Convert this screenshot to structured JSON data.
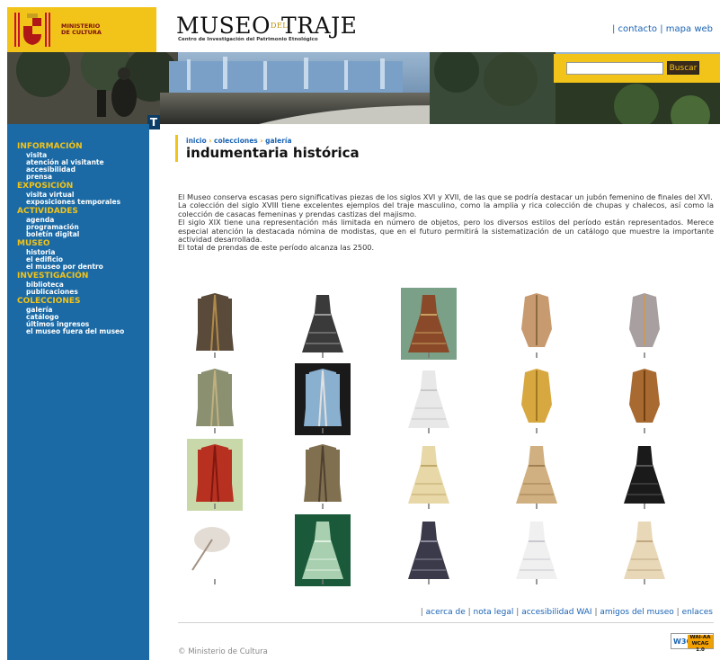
{
  "header": {
    "ministry_line1": "MINISTERIO",
    "ministry_line2": "DE CULTURA",
    "logo_part1": "MUSEO",
    "logo_part_del": "DEL",
    "logo_part2": "TRAJE",
    "logo_subtitle": "Centro de Investigación del Patrimonio Etnológico",
    "links": [
      {
        "label": "contacto"
      },
      {
        "label": "mapa web"
      }
    ],
    "link_separator": "|"
  },
  "search": {
    "value": "",
    "button_label": "Buscar"
  },
  "sidebar": {
    "tab_letter": "T",
    "sections": [
      {
        "title": "INFORMACIÓN",
        "items": [
          "visita",
          "atención al visitante",
          "accesibilidad",
          "prensa"
        ]
      },
      {
        "title": "EXPOSICIÓN",
        "items": [
          "visita virtual",
          "exposiciones temporales"
        ]
      },
      {
        "title": "ACTIVIDADES",
        "items": [
          "agenda",
          "programación",
          "boletín digital"
        ]
      },
      {
        "title": "MUSEO",
        "items": [
          "historia",
          "el edificio",
          "el museo por dentro"
        ]
      },
      {
        "title": "INVESTIGACIÓN",
        "items": [
          "biblioteca",
          "publicaciones"
        ]
      },
      {
        "title": "COLECCIONES",
        "items": [
          "galería",
          "catálogo",
          "últimos ingresos",
          "el museo fuera del museo"
        ]
      }
    ]
  },
  "breadcrumb": {
    "items": [
      "inicio",
      "colecciones",
      "galería"
    ],
    "separator": "›"
  },
  "page_title": "indumentaria histórica",
  "intro": [
    "El Museo conserva escasas pero significativas piezas de los siglos XVI y XVII, de las que se podría destacar un jubón femenino de finales del XVI.",
    "La colección del siglo XVIII tiene excelentes ejemplos del traje masculino, como la amplia y rica colección de chupas y chalecos, así como la colección de casacas femeninas y prendas castizas del majismo.",
    "El siglo XIX tiene una representación más limitada en número de objetos, pero los diversos estilos del período están representados. Merece especial atención la destacada nómina de modistas, que en el futuro permitirá la sistematización de un catálogo que muestre la importante actividad desarrollada.",
    "El total de prendas de este período alcanza las 2500."
  ],
  "gallery": [
    {
      "icon": "frock-coat-icon",
      "garment": "#5a4a3a",
      "trim": "#b08a4a",
      "bg": ""
    },
    {
      "icon": "plaid-dress-icon",
      "garment": "#3a3a3a",
      "trim": "#9a9a9a",
      "bg": ""
    },
    {
      "icon": "striped-dress-icon",
      "garment": "#8a4a2a",
      "trim": "#c8a060",
      "bg": "#7aa088"
    },
    {
      "icon": "jacket-icon",
      "garment": "#c89a70",
      "trim": "#8a6a40",
      "bg": ""
    },
    {
      "icon": "bodice-icon",
      "garment": "#a8a0a0",
      "trim": "#c89a60",
      "bg": ""
    },
    {
      "icon": "embroidered-coat-icon",
      "garment": "#8a9070",
      "trim": "#c0b080",
      "bg": ""
    },
    {
      "icon": "blue-coat-icon",
      "garment": "#8ab0d0",
      "trim": "#e0e0e0",
      "bg": "#1a1a1a"
    },
    {
      "icon": "white-gown-icon",
      "garment": "#e8e8e8",
      "trim": "#c8c8c8",
      "bg": ""
    },
    {
      "icon": "yellow-waistcoat-icon",
      "garment": "#d8a840",
      "trim": "#a07820",
      "bg": ""
    },
    {
      "icon": "brown-waistcoat-icon",
      "garment": "#a86a30",
      "trim": "#704010",
      "bg": ""
    },
    {
      "icon": "red-coat-icon",
      "garment": "#b83020",
      "trim": "#801810",
      "bg": "#c8d8a8"
    },
    {
      "icon": "cape-icon",
      "garment": "#807050",
      "trim": "#504030",
      "bg": ""
    },
    {
      "icon": "cream-dress-icon",
      "garment": "#e8d8a8",
      "trim": "#c0a868",
      "bg": ""
    },
    {
      "icon": "gold-dress-icon",
      "garment": "#d0b080",
      "trim": "#a08050",
      "bg": ""
    },
    {
      "icon": "black-dress-icon",
      "garment": "#1a1a1a",
      "trim": "#555555",
      "bg": ""
    },
    {
      "icon": "parasol-icon",
      "garment": "#e0d8d0",
      "trim": "#a09080",
      "bg": ""
    },
    {
      "icon": "crinoline-icon",
      "garment": "#a8d0b0",
      "trim": "#e0f0e0",
      "bg": "#1a5a3a"
    },
    {
      "icon": "bustle-dress-icon",
      "garment": "#3a3a4a",
      "trim": "#8a8a9a",
      "bg": ""
    },
    {
      "icon": "wedding-gown-icon",
      "garment": "#f0f0f0",
      "trim": "#c8c8d0",
      "bg": ""
    },
    {
      "icon": "ivory-dress-icon",
      "garment": "#e8d8b8",
      "trim": "#c0a880",
      "bg": ""
    }
  ],
  "footer": {
    "links": [
      "acerca de",
      "nota legal",
      "accesibilidad WAI",
      "amigos del museo",
      "enlaces"
    ],
    "separator": "|",
    "copyright": "© Ministerio de Cultura",
    "badge_w3c": "W3C",
    "badge_wai_line1": "WAI-AA",
    "badge_wai_line2": "WCAG 1.0"
  }
}
